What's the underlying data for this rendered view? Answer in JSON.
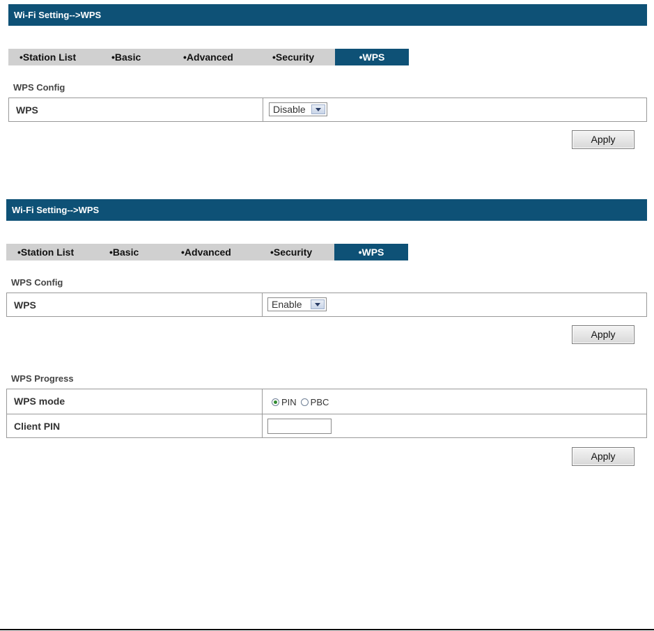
{
  "panel1": {
    "title": "Wi-Fi Setting-->WPS",
    "tabs": [
      "•Station List",
      "•Basic",
      "•Advanced",
      "•Security",
      "•WPS"
    ],
    "active_tab": "•WPS",
    "config_section": "WPS Config",
    "wps_label": "WPS",
    "wps_value": "Disable",
    "apply_label": "Apply"
  },
  "panel2": {
    "title": "Wi-Fi Setting-->WPS",
    "tabs": [
      "•Station List",
      "•Basic",
      "•Advanced",
      "•Security",
      "•WPS"
    ],
    "active_tab": "•WPS",
    "config_section": "WPS Config",
    "wps_label": "WPS",
    "wps_value": "Enable",
    "apply_label": "Apply",
    "progress_section": "WPS Progress",
    "wps_mode_label": "WPS mode",
    "mode_options": [
      "PIN",
      "PBC"
    ],
    "mode_selected": "PIN",
    "client_pin_label": "Client PIN",
    "client_pin_value": "",
    "apply2_label": "Apply"
  },
  "colors": {
    "header_bg": "#0e5176",
    "tab_bar_bg": "#d0d0d0",
    "border": "#999999"
  }
}
